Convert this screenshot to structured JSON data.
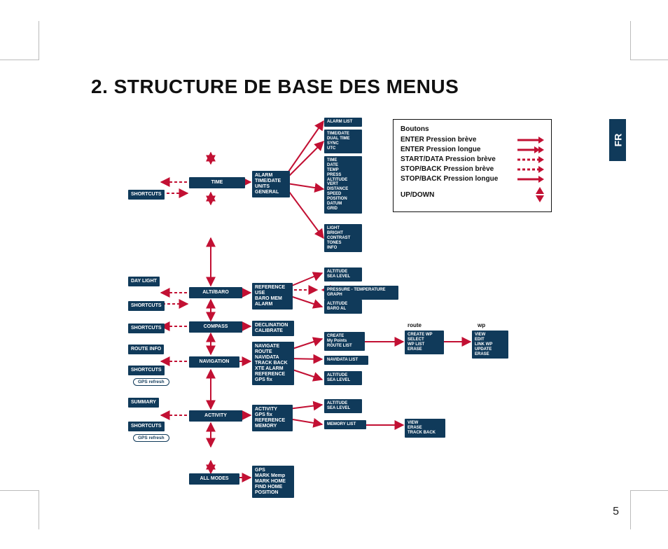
{
  "title": "2. STRUCTURE DE BASE DES MENUS",
  "lang_tab": "FR",
  "page_number": "5",
  "legend": {
    "title": "Boutons",
    "rows": [
      {
        "label": "ENTER Pression brève",
        "style": "solid"
      },
      {
        "label": "ENTER Pression longue",
        "style": "doublehead"
      },
      {
        "label": "START/DATA Pression brève",
        "style": "dashed"
      },
      {
        "label": "STOP/BACK Pression brève",
        "style": "dashed"
      },
      {
        "label": "STOP/BACK Pression longue",
        "style": "solid"
      }
    ],
    "updown": "UP/DOWN"
  },
  "notes": {
    "route": "route",
    "wp": "wp"
  },
  "modes": {
    "time": "TIME",
    "altibaro": "ALTI/BARO",
    "compass": "COMPASS",
    "navigation": "NAVIGATION",
    "activity": "ACTIVITY",
    "allmodes": "ALL MODES"
  },
  "side": {
    "shortcuts": "SHORTCUTS",
    "daylight": "DAY LIGHT",
    "routeinfo": "ROUTE INFO",
    "summary": "SUMMARY",
    "gpsrefresh": "GPS refresh"
  },
  "sub": {
    "time_set": "ALARM\nTIME/DATE\nUNITS\nGENERAL",
    "alarmlist": "ALARM LIST",
    "timedate": "TIME/DATE\nDUAL TIME\nSYNC\nUTC",
    "units": "TIME\nDATE\nTEMP\nPRESS\nALTITUDE\nVERT\nDISTANCE\nSPEED\nPOSITION\nDATUM\nGRID",
    "general": "LIGHT\nBRIGHT\nCONTRAST\nTONES\nINFO",
    "ab_set": "REFERENCE\nUSE\nBARO MEM\nALARM",
    "ab_ref": "ALTITUDE\nSEA LEVEL",
    "ab_graph": "PRESSURE - TEMPERATURE  GRAPH",
    "ab_use": "ALTITUDE\nBARO AL",
    "compass_set": "DECLINATION\nCALIBRATE",
    "nav_set": "NAVIGATE\nROUTE\nNAVIDATA\nTRACK BACK\nXTE ALARM\nREFERENCE\nGPS fix",
    "nav_route": "CREATE\nMy Points\nROUTE LIST",
    "nav_navidata": "NAVIDATA LIST",
    "nav_ref": "ALTITUDE\nSEA LEVEL",
    "nav_routeops": "CREATE WP\nSELECT\nWP LIST\nERASE",
    "nav_wp": "VIEW\nEDIT\nLINK WP\nUPDATE\nERASE",
    "act_set": "ACTIVITY\nGPS fix\nREFERENCE\nMEMORY",
    "act_ref": "ALTITUDE\nSEA LEVEL",
    "act_mem": "MEMORY LIST",
    "act_memops": "VIEW\nERASE\nTRACK BACK",
    "all_set": "GPS\nMARK Memp\nMARK HOME\nFIND HOME\nPOSITION"
  }
}
